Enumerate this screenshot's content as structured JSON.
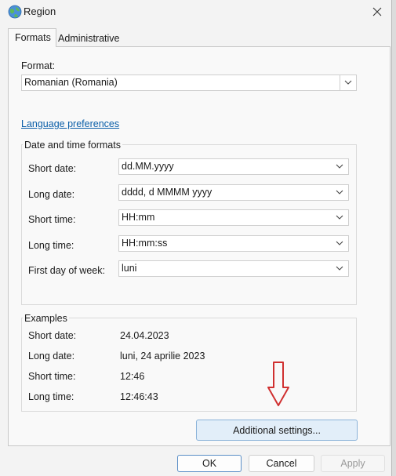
{
  "window": {
    "title": "Region",
    "close_label": "Close"
  },
  "tabs": [
    {
      "label": "Formats",
      "active": true
    },
    {
      "label": "Administrative",
      "active": false
    }
  ],
  "format": {
    "label": "Format:",
    "value": "Romanian (Romania)"
  },
  "language_link": "Language preferences",
  "date_time_formats": {
    "title": "Date and time formats",
    "fields": [
      {
        "label": "Short date:",
        "value": "dd.MM.yyyy"
      },
      {
        "label": "Long date:",
        "value": "dddd, d MMMM yyyy"
      },
      {
        "label": "Short time:",
        "value": "HH:mm"
      },
      {
        "label": "Long time:",
        "value": "HH:mm:ss"
      },
      {
        "label": "First day of week:",
        "value": "luni"
      }
    ]
  },
  "examples": {
    "title": "Examples",
    "rows": [
      {
        "label": "Short date:",
        "value": "24.04.2023"
      },
      {
        "label": "Long date:",
        "value": "luni, 24 aprilie 2023"
      },
      {
        "label": "Short time:",
        "value": "12:46"
      },
      {
        "label": "Long time:",
        "value": "12:46:43"
      }
    ]
  },
  "buttons": {
    "additional_settings": "Additional settings...",
    "ok": "OK",
    "cancel": "Cancel",
    "apply": "Apply"
  },
  "colors": {
    "link": "#0a5ea8",
    "annotation_arrow": "#d03030",
    "highlight_button": "#e2eef9"
  },
  "icons": {
    "app": "globe-icon",
    "close": "close-icon",
    "dropdown": "chevron-down-icon",
    "annotation": "arrow-down-icon"
  }
}
